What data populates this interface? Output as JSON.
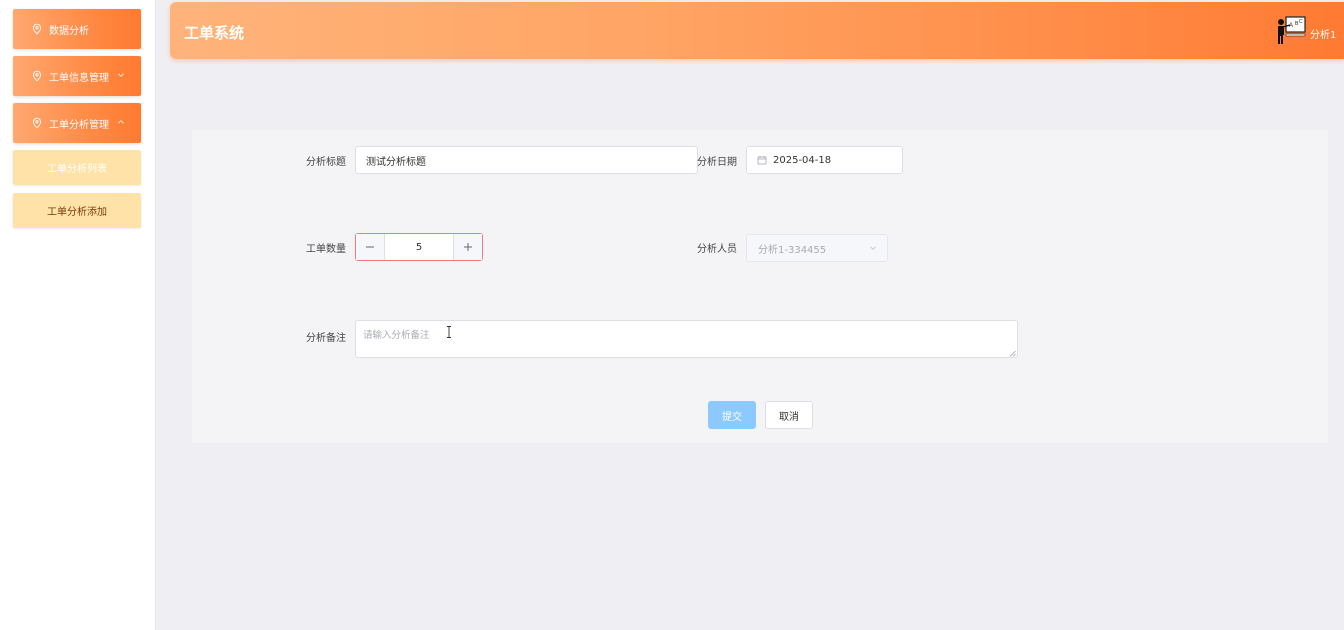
{
  "app": {
    "title": "工单系统"
  },
  "user": {
    "name": "分析1"
  },
  "sidebar": {
    "items": [
      {
        "label": "数据分析",
        "chevron": ""
      },
      {
        "label": "工单信息管理",
        "chevron": "chevron-down"
      },
      {
        "label": "工单分析管理",
        "chevron": "chevron-up"
      }
    ],
    "subitems": [
      {
        "label": "工单分析列表"
      },
      {
        "label": "工单分析添加"
      }
    ]
  },
  "form": {
    "title_label": "分析标题",
    "title_value": "测试分析标题",
    "date_label": "分析日期",
    "date_value": "2025-04-18",
    "count_label": "工单数量",
    "count_value": "5",
    "staff_label": "分析人员",
    "staff_value": "分析1-334455",
    "notes_label": "分析备注",
    "notes_placeholder": "请输入分析备注",
    "submit_label": "提交",
    "cancel_label": "取消"
  },
  "colors": {
    "accent": "#ff8a45",
    "submenu": "#ffe2a8",
    "primary_button": "#8cc9ff",
    "stepper_border": "#f27a7a"
  }
}
